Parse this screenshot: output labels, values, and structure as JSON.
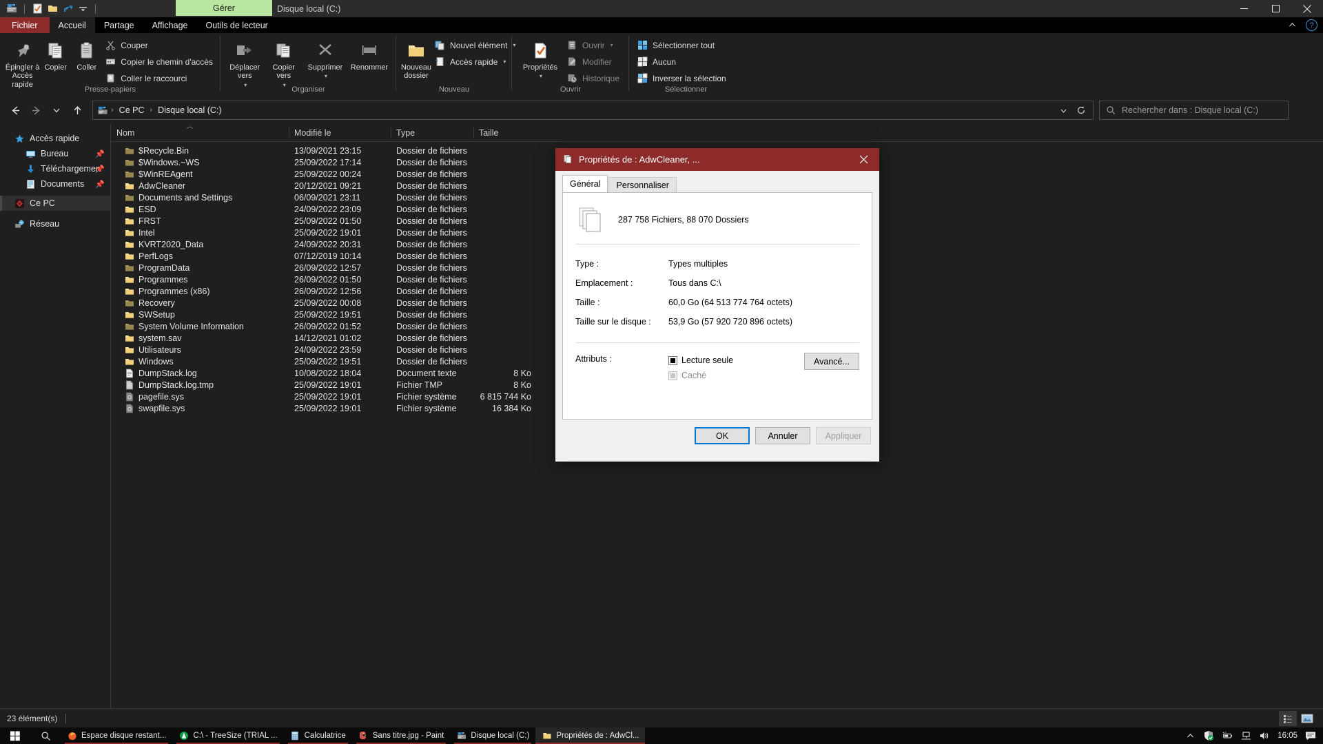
{
  "window": {
    "title": "Disque local (C:)",
    "contextual_tab": "Gérer",
    "quick_access_icons": [
      "properties-icon",
      "new-folder-icon",
      "undo-icon",
      "customize-qat-icon"
    ],
    "buttons": {
      "minimize": "minimize-button",
      "maximize": "maximize-button",
      "close": "close-button"
    }
  },
  "ribbon": {
    "tabs": [
      {
        "label": "Fichier",
        "kind": "file"
      },
      {
        "label": "Accueil",
        "kind": "active"
      },
      {
        "label": "Partage",
        "kind": "normal"
      },
      {
        "label": "Affichage",
        "kind": "normal"
      },
      {
        "label": "Outils de lecteur",
        "kind": "normal"
      }
    ],
    "collapse_icon": "chevron-up-icon",
    "help_icon": "help-icon",
    "groups": [
      {
        "label": "Presse-papiers",
        "big": [
          {
            "label": "Épingler à\nAccès rapide",
            "icon": "pin-icon"
          },
          {
            "label": "Copier",
            "icon": "copy-icon"
          },
          {
            "label": "Coller",
            "icon": "paste-icon"
          }
        ],
        "small": [
          {
            "label": "Couper",
            "icon": "scissors-icon",
            "dim": false
          },
          {
            "label": "Copier le chemin d'accès",
            "icon": "copy-path-icon",
            "dim": false
          },
          {
            "label": "Coller le raccourci",
            "icon": "paste-shortcut-icon",
            "dim": false
          }
        ]
      },
      {
        "label": "Organiser",
        "big": [
          {
            "label": "Déplacer\nvers",
            "icon": "move-to-icon",
            "caret": true
          },
          {
            "label": "Copier\nvers",
            "icon": "copy-to-icon",
            "caret": true
          },
          {
            "label": "Supprimer",
            "icon": "delete-icon",
            "caret": true
          },
          {
            "label": "Renommer",
            "icon": "rename-icon"
          }
        ],
        "small": []
      },
      {
        "label": "Nouveau",
        "big": [
          {
            "label": "Nouveau\ndossier",
            "icon": "new-folder-icon"
          }
        ],
        "small": [
          {
            "label": "Nouvel élément",
            "icon": "new-item-icon",
            "caret": true
          },
          {
            "label": "Accès rapide",
            "icon": "quick-access-icon",
            "caret": true
          }
        ]
      },
      {
        "label": "Ouvrir",
        "big": [
          {
            "label": "Propriétés",
            "icon": "properties-icon",
            "caret": true
          }
        ],
        "small": [
          {
            "label": "Ouvrir",
            "icon": "open-icon",
            "caret": true,
            "dim": true
          },
          {
            "label": "Modifier",
            "icon": "edit-icon",
            "dim": true
          },
          {
            "label": "Historique",
            "icon": "history-icon",
            "dim": true
          }
        ]
      },
      {
        "label": "Sélectionner",
        "big": [],
        "small": [
          {
            "label": "Sélectionner tout",
            "icon": "select-all-icon"
          },
          {
            "label": "Aucun",
            "icon": "select-none-icon"
          },
          {
            "label": "Inverser la sélection",
            "icon": "invert-selection-icon"
          }
        ]
      }
    ]
  },
  "address_bar": {
    "back_icon": "back-arrow-icon",
    "forward_icon": "forward-arrow-icon",
    "recent_icon": "recent-locations-icon",
    "up_icon": "up-arrow-icon",
    "drive_icon": "drive-icon",
    "crumbs": [
      "Ce PC",
      "Disque local (C:)"
    ],
    "dropdown_icon": "chevron-down-icon",
    "refresh_icon": "refresh-icon",
    "search_placeholder": "Rechercher dans : Disque local (C:)",
    "search_icon": "search-icon"
  },
  "nav_pane": {
    "items": [
      {
        "label": "Accès rapide",
        "icon": "star-icon",
        "indent": false,
        "pinned": false,
        "selected": false
      },
      {
        "label": "Bureau",
        "icon": "desktop-icon",
        "indent": true,
        "pinned": true,
        "selected": false
      },
      {
        "label": "Téléchargements",
        "icon": "downloads-icon",
        "indent": true,
        "pinned": true,
        "selected": false
      },
      {
        "label": "Documents",
        "icon": "documents-icon",
        "indent": true,
        "pinned": true,
        "selected": false
      },
      {
        "label": "Ce PC",
        "icon": "this-pc-icon",
        "indent": false,
        "pinned": false,
        "selected": true
      },
      {
        "label": "Réseau",
        "icon": "network-icon",
        "indent": false,
        "pinned": false,
        "selected": false
      }
    ],
    "pin_glyph": "📌"
  },
  "file_list": {
    "columns": [
      "Nom",
      "Modifié le",
      "Type",
      "Taille"
    ],
    "sort_column": "Nom",
    "sort_direction": "asc",
    "rows": [
      {
        "name": "$Recycle.Bin",
        "modified": "13/09/2021 23:15",
        "type": "Dossier de fichiers",
        "size": "",
        "icon": "folder-dim-icon"
      },
      {
        "name": "$Windows.~WS",
        "modified": "25/09/2022 17:14",
        "type": "Dossier de fichiers",
        "size": "",
        "icon": "folder-dim-icon"
      },
      {
        "name": "$WinREAgent",
        "modified": "25/09/2022 00:24",
        "type": "Dossier de fichiers",
        "size": "",
        "icon": "folder-dim-icon"
      },
      {
        "name": "AdwCleaner",
        "modified": "20/12/2021 09:21",
        "type": "Dossier de fichiers",
        "size": "",
        "icon": "folder-icon"
      },
      {
        "name": "Documents and Settings",
        "modified": "06/09/2021 23:11",
        "type": "Dossier de fichiers",
        "size": "",
        "icon": "folder-dim-icon"
      },
      {
        "name": "ESD",
        "modified": "24/09/2022 23:09",
        "type": "Dossier de fichiers",
        "size": "",
        "icon": "folder-icon"
      },
      {
        "name": "FRST",
        "modified": "25/09/2022 01:50",
        "type": "Dossier de fichiers",
        "size": "",
        "icon": "folder-icon"
      },
      {
        "name": "Intel",
        "modified": "25/09/2022 19:01",
        "type": "Dossier de fichiers",
        "size": "",
        "icon": "folder-icon"
      },
      {
        "name": "KVRT2020_Data",
        "modified": "24/09/2022 20:31",
        "type": "Dossier de fichiers",
        "size": "",
        "icon": "folder-icon"
      },
      {
        "name": "PerfLogs",
        "modified": "07/12/2019 10:14",
        "type": "Dossier de fichiers",
        "size": "",
        "icon": "folder-icon"
      },
      {
        "name": "ProgramData",
        "modified": "26/09/2022 12:57",
        "type": "Dossier de fichiers",
        "size": "",
        "icon": "folder-dim-icon"
      },
      {
        "name": "Programmes",
        "modified": "26/09/2022 01:50",
        "type": "Dossier de fichiers",
        "size": "",
        "icon": "folder-icon"
      },
      {
        "name": "Programmes (x86)",
        "modified": "26/09/2022 12:56",
        "type": "Dossier de fichiers",
        "size": "",
        "icon": "folder-icon"
      },
      {
        "name": "Recovery",
        "modified": "25/09/2022 00:08",
        "type": "Dossier de fichiers",
        "size": "",
        "icon": "folder-dim-icon"
      },
      {
        "name": "SWSetup",
        "modified": "25/09/2022 19:51",
        "type": "Dossier de fichiers",
        "size": "",
        "icon": "folder-icon"
      },
      {
        "name": "System Volume Information",
        "modified": "26/09/2022 01:52",
        "type": "Dossier de fichiers",
        "size": "",
        "icon": "folder-dim-icon"
      },
      {
        "name": "system.sav",
        "modified": "14/12/2021 01:02",
        "type": "Dossier de fichiers",
        "size": "",
        "icon": "folder-icon"
      },
      {
        "name": "Utilisateurs",
        "modified": "24/09/2022 23:59",
        "type": "Dossier de fichiers",
        "size": "",
        "icon": "folder-icon"
      },
      {
        "name": "Windows",
        "modified": "25/09/2022 19:51",
        "type": "Dossier de fichiers",
        "size": "",
        "icon": "folder-icon"
      },
      {
        "name": "DumpStack.log",
        "modified": "10/08/2022 18:04",
        "type": "Document texte",
        "size": "8 Ko",
        "icon": "text-file-icon"
      },
      {
        "name": "DumpStack.log.tmp",
        "modified": "25/09/2022 19:01",
        "type": "Fichier TMP",
        "size": "8 Ko",
        "icon": "generic-file-icon"
      },
      {
        "name": "pagefile.sys",
        "modified": "25/09/2022 19:01",
        "type": "Fichier système",
        "size": "6 815 744 Ko",
        "icon": "system-file-icon"
      },
      {
        "name": "swapfile.sys",
        "modified": "25/09/2022 19:01",
        "type": "Fichier système",
        "size": "16 384 Ko",
        "icon": "system-file-icon"
      }
    ]
  },
  "status_bar": {
    "item_count": "23 élément(s)",
    "view_details_icon": "details-view-icon",
    "view_large_icons_icon": "large-icons-view-icon",
    "active_view": "large-icons-view-icon"
  },
  "dialog": {
    "title": "Propriétés de : AdwCleaner, ...",
    "title_icon": "multiple-files-icon",
    "close_icon": "close-icon",
    "tabs": [
      {
        "label": "Général",
        "active": true
      },
      {
        "label": "Personnaliser",
        "active": false
      }
    ],
    "summary": "287 758 Fichiers, 88 070 Dossiers",
    "summary_icon": "multiple-files-large-icon",
    "properties": [
      {
        "key": "Type :",
        "value": "Types multiples"
      },
      {
        "key": "Emplacement :",
        "value": "Tous dans C:\\"
      },
      {
        "key": "Taille :",
        "value": "60,0 Go (64 513 774 764 octets)"
      },
      {
        "key": "Taille sur le disque :",
        "value": "53,9 Go (57 920 720 896 octets)"
      }
    ],
    "attributes_label": "Attributs :",
    "attributes": [
      {
        "label": "Lecture seule",
        "state": "filled",
        "disabled": false
      },
      {
        "label": "Caché",
        "state": "filled",
        "disabled": true
      }
    ],
    "advanced_button": "Avancé...",
    "footer_buttons": [
      {
        "label": "OK",
        "style": "default"
      },
      {
        "label": "Annuler",
        "style": "normal"
      },
      {
        "label": "Appliquer",
        "style": "disabled"
      }
    ]
  },
  "taskbar": {
    "start_icon": "windows-start-icon",
    "search_icon": "search-icon",
    "items": [
      {
        "label": "Espace disque restant...",
        "icon": "firefox-icon",
        "active": false,
        "open": true
      },
      {
        "label": "C:\\ - TreeSize  (TRIAL ...",
        "icon": "treesize-icon",
        "active": false,
        "open": true
      },
      {
        "label": "Calculatrice",
        "icon": "calculator-icon",
        "active": false,
        "open": true
      },
      {
        "label": "Sans titre.jpg - Paint",
        "icon": "paint-icon",
        "active": false,
        "open": true
      },
      {
        "label": "Disque local (C:)",
        "icon": "explorer-icon",
        "active": false,
        "open": true
      },
      {
        "label": "Propriétés de : AdwCl...",
        "icon": "folder-icon",
        "active": true,
        "open": true
      }
    ],
    "tray": {
      "overflow_icon": "chevron-up-icon",
      "icons": [
        "defender-icon",
        "battery-icon",
        "network-icon",
        "volume-icon"
      ],
      "clock": "16:05",
      "notifications_icon": "action-center-icon"
    }
  },
  "colors": {
    "accent_dark_red": "#8d2b2b",
    "contextual_green": "#b9e6a0",
    "window_bg": "#1f1f1f",
    "dialog_bg": "#f0f0f0",
    "focus_blue": "#0078d7"
  }
}
